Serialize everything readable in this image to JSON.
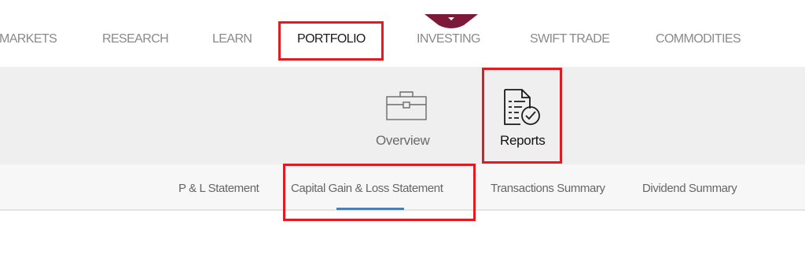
{
  "top_nav": {
    "items": [
      {
        "label": "MARKETS",
        "active": false
      },
      {
        "label": "RESEARCH",
        "active": false
      },
      {
        "label": "LEARN",
        "active": false
      },
      {
        "label": "PORTFOLIO",
        "active": true
      },
      {
        "label": "INVESTING",
        "active": false
      },
      {
        "label": "SWIFT TRADE",
        "active": false
      },
      {
        "label": "COMMODITIES",
        "active": false
      }
    ],
    "marker_icon": "caret-down-icon",
    "marker_color": "#7d1a3a"
  },
  "sub_nav": {
    "items": [
      {
        "label": "Overview",
        "icon": "briefcase-icon",
        "active": false
      },
      {
        "label": "Reports",
        "icon": "report-document-check-icon",
        "active": true
      }
    ]
  },
  "report_tabs": {
    "items": [
      {
        "label": "P & L Statement",
        "active": false
      },
      {
        "label": "Capital Gain & Loss Statement",
        "active": true
      },
      {
        "label": "Transactions Summary",
        "active": false
      },
      {
        "label": "Dividend Summary",
        "active": false
      }
    ],
    "active_underline_color": "#4a7fb0"
  },
  "highlight_color": "#e11b22"
}
